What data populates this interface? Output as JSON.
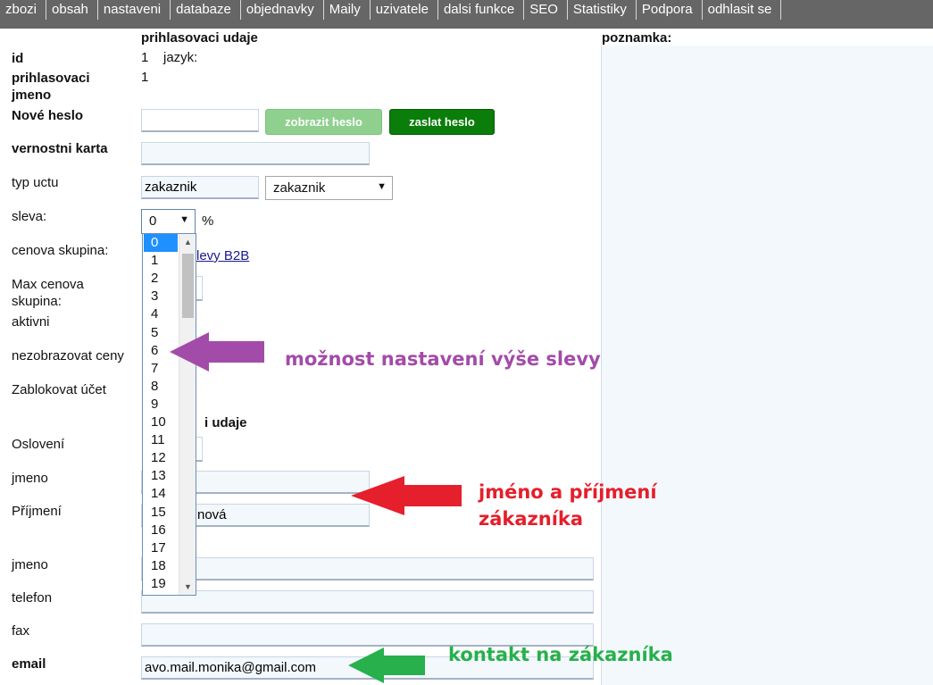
{
  "nav": {
    "items": [
      "zbozi",
      "obsah",
      "nastaveni",
      "databaze",
      "objednavky",
      "Maily",
      "uzivatele",
      "dalsi funkce",
      "SEO",
      "Statistiky",
      "Podpora",
      "odhlasit se"
    ]
  },
  "section": {
    "login_title": "prihlasovaci udaje",
    "contact_title_partial": "i udaje",
    "note_title": "poznamka:"
  },
  "form": {
    "id_label": "id",
    "id_value": "1",
    "lang_label": "jazyk:",
    "login_label_1": "prihlasovaci",
    "login_label_2": "jmeno",
    "login_value": "1",
    "new_password_label": "Nové heslo",
    "show_password_btn": "zobrazit heslo",
    "send_password_btn": "zaslat heslo",
    "loyalty_label": "vernostni karta",
    "account_type_label": "typ uctu",
    "account_type_value": "zakaznik",
    "account_type_select": "zakaznik",
    "discount_label": "sleva:",
    "discount_value": "0",
    "percent": "%",
    "price_group_label": "cenova skupina:",
    "price_group_link_partial": "levy B2B",
    "max_price_group_label_1": "Max cenova",
    "max_price_group_label_2": "skupina:",
    "active_label": "aktivni",
    "hide_prices_label": "nezobrazovat ceny",
    "block_account_label": "Zablokovat účet",
    "salutation_label": "Oslovení",
    "first_name_label": "jmeno",
    "surname_label": "Příjmení",
    "surname_value_partial": "nová",
    "contact_name_label": "jmeno",
    "phone_label": "telefon",
    "fax_label": "fax",
    "email_label": "email",
    "email_value": "avo.mail.monika@gmail.com"
  },
  "dropdown": {
    "options": [
      "0",
      "1",
      "2",
      "3",
      "4",
      "5",
      "6",
      "7",
      "8",
      "9",
      "10",
      "11",
      "12",
      "13",
      "14",
      "15",
      "16",
      "17",
      "18",
      "19"
    ],
    "selected": "0"
  },
  "annotations": {
    "discount_note": "možnost nastavení výše slevy",
    "name_note_1": "jméno a příjmení",
    "name_note_2": "zákazníka",
    "contact_note": "kontakt na zákazníka"
  },
  "colors": {
    "nav_bg": "#666666",
    "show_btn": "#8fd08f",
    "send_btn": "#0a7d0a",
    "ann_purple": "#a34ba9",
    "ann_red": "#e51f2b",
    "ann_green": "#27b04b"
  }
}
